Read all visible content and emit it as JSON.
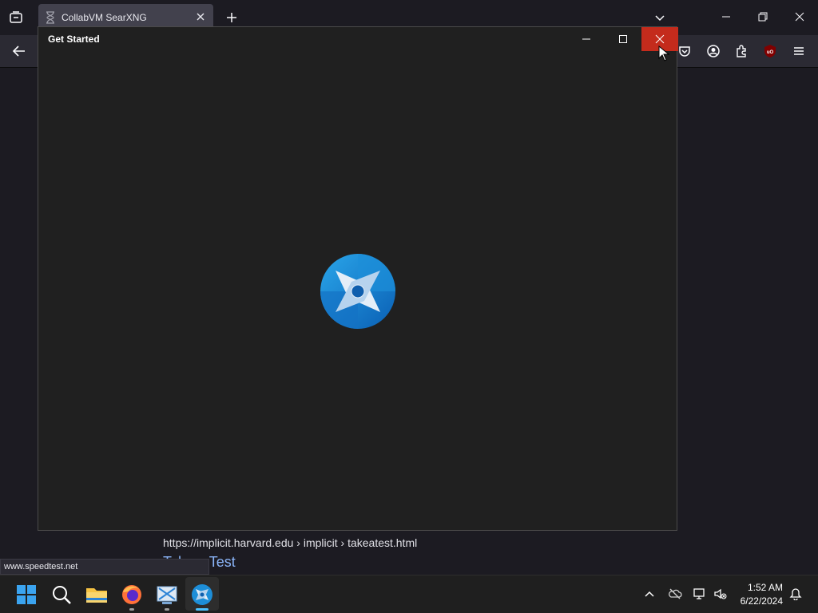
{
  "browser": {
    "tab_title": "CollabVM SearXNG",
    "status_url": "www.speedtest.net"
  },
  "search_result": {
    "url": "https://implicit.harvard.edu  › implicit › takeatest.html",
    "title_partial": "Take a Test"
  },
  "app_window": {
    "title": "Get Started"
  },
  "taskbar": {
    "time": "1:52 AM",
    "date": "6/22/2024",
    "pinned": [
      "start-icon",
      "search-icon",
      "file-explorer-icon",
      "firefox-icon",
      "vm-app-icon",
      "get-started-icon"
    ]
  },
  "colors": {
    "close_hover": "#c42b1c",
    "app_bg": "#202020",
    "browser_bg": "#1c1b22",
    "link": "#8ab4f8"
  }
}
